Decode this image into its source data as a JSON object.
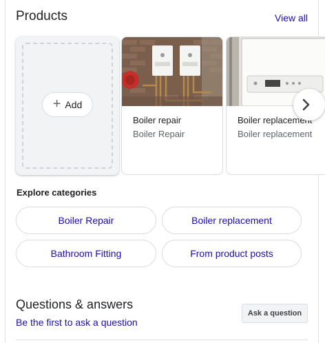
{
  "products": {
    "title": "Products",
    "view_all": "View all",
    "add_label": "Add",
    "cards": [
      {
        "name": "Boiler repair",
        "category": "Boiler Repair",
        "image": "two wall-mounted boilers on brick wall"
      },
      {
        "name": "Boiler replacement",
        "category": "Boiler replacement",
        "image": "white boiler unit close-up"
      }
    ],
    "next_icon": "chevron-right-icon"
  },
  "categories": {
    "heading": "Explore categories",
    "chips": [
      "Boiler Repair",
      "Boiler replacement",
      "Bathroom Fitting",
      "From product posts"
    ]
  },
  "qa": {
    "title": "Questions & answers",
    "first_link": "Be the first to ask a question",
    "ask_button": "Ask a question"
  },
  "colors": {
    "link": "#1a0dab",
    "text": "#202124",
    "muted": "#5f6368",
    "border": "#dadce0"
  }
}
